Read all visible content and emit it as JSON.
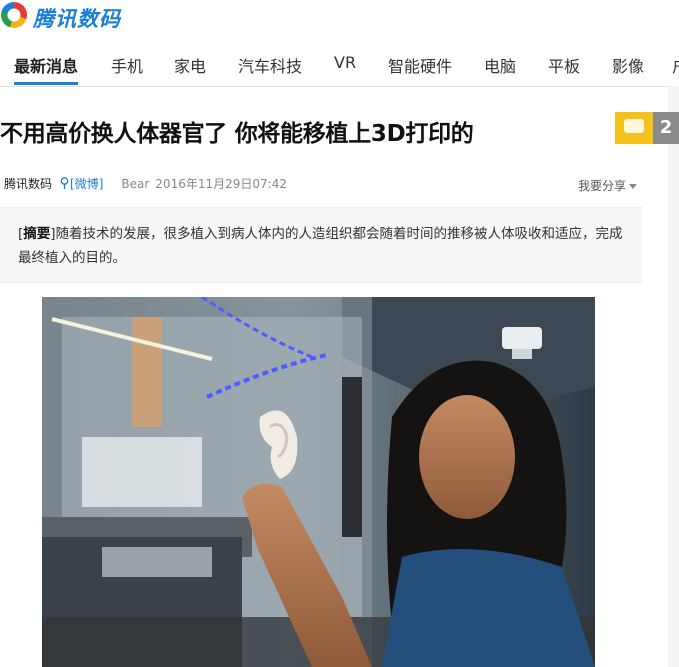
{
  "logo": {
    "text": "腾讯数码"
  },
  "nav": {
    "items": [
      {
        "label": "最新消息"
      },
      {
        "label": "手机"
      },
      {
        "label": "家电"
      },
      {
        "label": "汽车科技"
      },
      {
        "label": "VR"
      },
      {
        "label": "智能硬件"
      },
      {
        "label": "电脑"
      },
      {
        "label": "平板"
      },
      {
        "label": "影像"
      },
      {
        "label": "户"
      }
    ]
  },
  "article": {
    "title": "不用高价换人体器官了 你将能移植上3D打印的",
    "comment_count": "2",
    "source": "腾讯数码",
    "weibo": "[微博]",
    "author": "Bear",
    "date": "2016年11月29日07:42",
    "share": "我要分享",
    "summary_label": "摘要",
    "summary_text": "随着技术的发展，很多植入到病人体内的人造组织都会随着时间的推移被人体吸收和适应，完成最终植入的目的。"
  },
  "colors": {
    "accent": "#1a7fd5",
    "comment": "#f4c21c"
  },
  "icons": {
    "comment": "comment-icon",
    "share_caret": "chevron-down-icon",
    "weibo": "weibo-icon"
  }
}
